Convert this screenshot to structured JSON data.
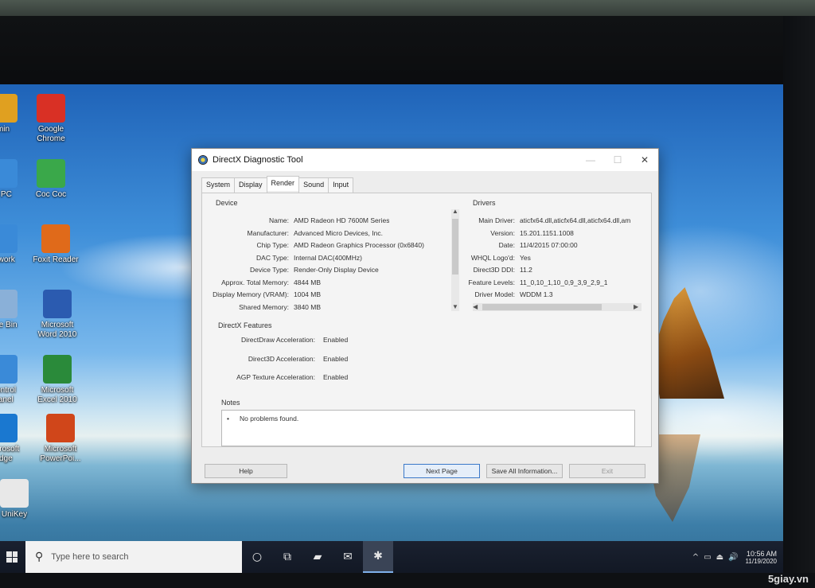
{
  "desktop": {
    "icons": [
      {
        "label": "min",
        "icon": "user-folder-icon",
        "color": "#e0a020"
      },
      {
        "label": "Google\nChrome",
        "icon": "chrome-icon",
        "color": "#d93025"
      },
      {
        "label": "s PC",
        "icon": "this-pc-icon",
        "color": "#3a8ad8"
      },
      {
        "label": "Coc Coc",
        "icon": "coccoc-icon",
        "color": "#3aa84a"
      },
      {
        "label": "etwork",
        "icon": "network-icon",
        "color": "#3a8ad8"
      },
      {
        "label": "Foxit Reader",
        "icon": "foxit-icon",
        "color": "#e06a1a"
      },
      {
        "label": "ycle Bin",
        "icon": "recycle-bin-icon",
        "color": "#8ab0d8"
      },
      {
        "label": "Microsoft\nWord 2010",
        "icon": "word-icon",
        "color": "#2b5bb0"
      },
      {
        "label": "Control\nPanel",
        "icon": "control-panel-icon",
        "color": "#3a8ad8"
      },
      {
        "label": "Microsoft\nExcel 2010",
        "icon": "excel-icon",
        "color": "#2a8a3a"
      },
      {
        "label": "Microsoft\nEdge",
        "icon": "edge-icon",
        "color": "#1a78d0"
      },
      {
        "label": "Microsoft\nPowerPoi...",
        "icon": "powerpoint-icon",
        "color": "#d0461a"
      },
      {
        "label": "UniKey",
        "icon": "unikey-icon",
        "color": "#e8e8e8"
      }
    ]
  },
  "dialog": {
    "title": "DirectX Diagnostic Tool",
    "controls": {
      "minimize": "—",
      "maximize": "☐",
      "close": "✕"
    },
    "tabs": [
      "System",
      "Display",
      "Render",
      "Sound",
      "Input"
    ],
    "active_tab": "Render",
    "device": {
      "heading": "Device",
      "rows": [
        {
          "k": "Name:",
          "v": "AMD Radeon HD 7600M Series"
        },
        {
          "k": "Manufacturer:",
          "v": "Advanced Micro Devices, Inc."
        },
        {
          "k": "Chip Type:",
          "v": "AMD Radeon Graphics Processor (0x6840)"
        },
        {
          "k": "DAC Type:",
          "v": "Internal DAC(400MHz)"
        },
        {
          "k": "Device Type:",
          "v": "Render-Only Display Device"
        },
        {
          "k": "Approx. Total Memory:",
          "v": "4844 MB"
        },
        {
          "k": "Display Memory (VRAM):",
          "v": "1004 MB"
        },
        {
          "k": "Shared Memory:",
          "v": "3840 MB"
        }
      ]
    },
    "drivers": {
      "heading": "Drivers",
      "rows": [
        {
          "k": "Main Driver:",
          "v": "aticfx64.dll,aticfx64.dll,aticfx64.dll,am"
        },
        {
          "k": "Version:",
          "v": "15.201.1151.1008"
        },
        {
          "k": "Date:",
          "v": "11/4/2015 07:00:00"
        },
        {
          "k": "WHQL Logo'd:",
          "v": "Yes"
        },
        {
          "k": "Direct3D DDI:",
          "v": "11.2"
        },
        {
          "k": "Feature Levels:",
          "v": "11_0,10_1,10_0,9_3,9_2,9_1"
        },
        {
          "k": "Driver Model:",
          "v": "WDDM 1.3"
        }
      ]
    },
    "features": {
      "heading": "DirectX Features",
      "rows": [
        {
          "k": "DirectDraw Acceleration:",
          "v": "Enabled"
        },
        {
          "k": "Direct3D Acceleration:",
          "v": "Enabled"
        },
        {
          "k": "AGP Texture Acceleration:",
          "v": "Enabled"
        }
      ]
    },
    "notes": {
      "heading": "Notes",
      "items": [
        "No problems found."
      ]
    },
    "buttons": {
      "help": "Help",
      "next": "Next Page",
      "save": "Save All Information...",
      "exit": "Exit"
    }
  },
  "taskbar": {
    "search_placeholder": "Type here to search",
    "apps": [
      {
        "icon": "cortana-icon",
        "glyph": "○"
      },
      {
        "icon": "task-view-icon",
        "glyph": "⧉"
      },
      {
        "icon": "file-explorer-icon",
        "glyph": "▰"
      },
      {
        "icon": "mail-icon",
        "glyph": "✉"
      },
      {
        "icon": "dxdiag-icon",
        "glyph": "✱"
      }
    ],
    "tray": [
      "^",
      "▭",
      "⏏",
      "🔊"
    ],
    "time": "10:56 AM",
    "date": "11/19/2020"
  },
  "watermark": "5giay.vn"
}
